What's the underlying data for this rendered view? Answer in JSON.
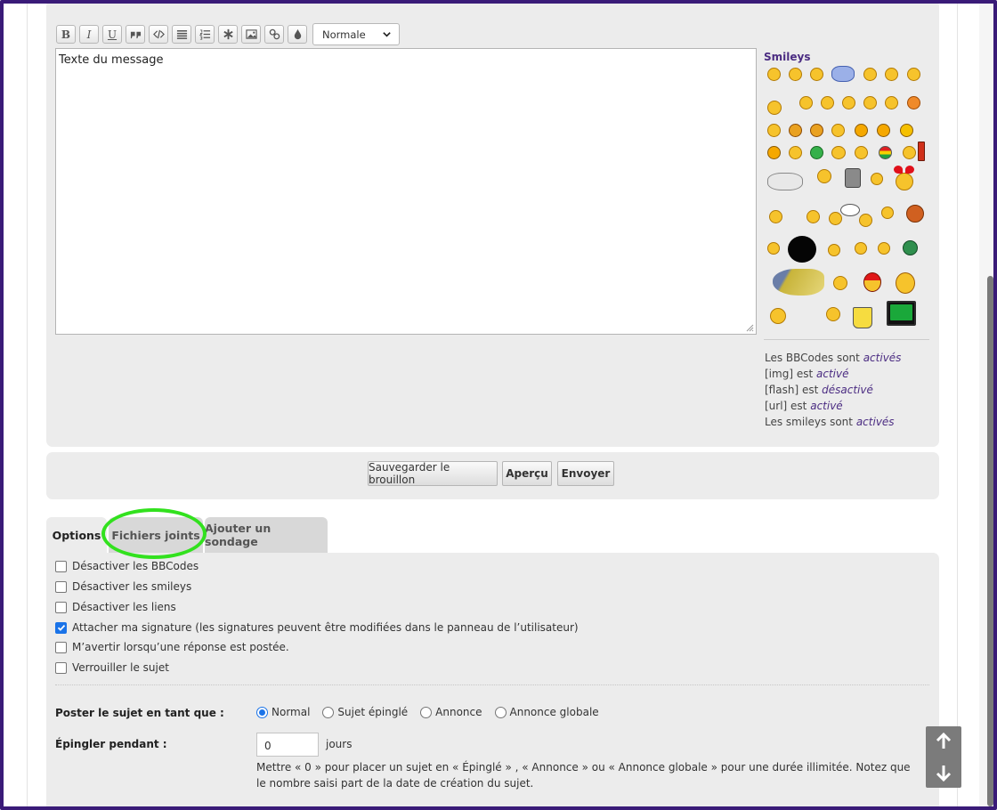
{
  "toolbar": {
    "buttons": [
      {
        "label": "B",
        "title": "bold"
      },
      {
        "label": "I",
        "title": "italic"
      },
      {
        "label": "U",
        "title": "underline"
      }
    ],
    "font_size_selected": "Normale"
  },
  "editor": {
    "message_placeholder": "Texte du message"
  },
  "smileys": {
    "title": "Smileys"
  },
  "status": {
    "bbcodes_prefix": "Les BBCodes sont",
    "bbcodes_state": "activés",
    "img_prefix": "[img] est",
    "img_state": "activé",
    "flash_prefix": "[flash] est",
    "flash_state": "désactivé",
    "url_prefix": "[url] est",
    "url_state": "activé",
    "smileys_prefix": "Les smileys sont",
    "smileys_state": "activés"
  },
  "actions": {
    "save_draft": "Sauvegarder le brouillon",
    "preview": "Aperçu",
    "submit": "Envoyer"
  },
  "tabs": [
    {
      "label": "Options",
      "active": true
    },
    {
      "label": "Fichiers joints",
      "active": false
    },
    {
      "label": "Ajouter un sondage",
      "active": false
    }
  ],
  "options": [
    {
      "label": "Désactiver les BBCodes",
      "checked": false
    },
    {
      "label": "Désactiver les smileys",
      "checked": false
    },
    {
      "label": "Désactiver les liens",
      "checked": false
    },
    {
      "label": "Attacher ma signature (les signatures peuvent être modifiées dans le panneau de l’utilisateur)",
      "checked": true
    },
    {
      "label": "M’avertir lorsqu’une réponse est postée.",
      "checked": false
    },
    {
      "label": "Verrouiller le sujet",
      "checked": false
    }
  ],
  "post_as": {
    "label": "Poster le sujet en tant que :",
    "choices": [
      {
        "label": "Normal",
        "selected": true
      },
      {
        "label": "Sujet épinglé",
        "selected": false
      },
      {
        "label": "Annonce",
        "selected": false
      },
      {
        "label": "Annonce globale",
        "selected": false
      }
    ]
  },
  "pin_duration": {
    "label": "Épingler pendant :",
    "value": "0",
    "unit": "jours",
    "hint": "Mettre « 0 » pour placer un sujet en « Épinglé » , « Annonce » ou « Annonce globale » pour une durée illimitée. Notez que le nombre saisi part de la date de création du sujet."
  },
  "colors": {
    "frame": "#3a1b78",
    "accent": "#4b2c82",
    "highlight": "#32e11e",
    "panel": "#ececec"
  }
}
